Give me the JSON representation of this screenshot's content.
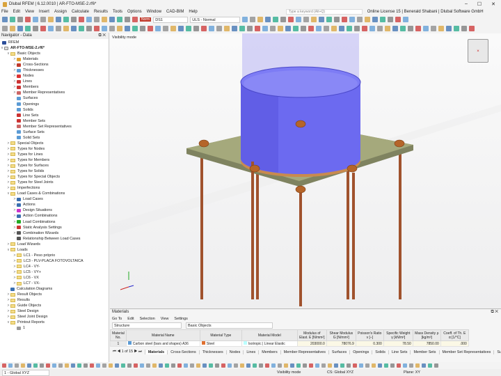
{
  "window": {
    "title": "Dlubal RFEM | 6.12.0010 | AR-FTO-MSE-2.rf6*",
    "min": "–",
    "max": "☐",
    "close": "✕"
  },
  "menu": {
    "items": [
      "File",
      "Edit",
      "View",
      "Insert",
      "Assign",
      "Calculate",
      "Results",
      "Tools",
      "Options",
      "Window",
      "CAD-BIM",
      "Help"
    ],
    "search_placeholder": "Type a keyword (Alt+Q)",
    "license": "Online License 15 | Benerald Shabani | Dlubal Software GmbH"
  },
  "toolbar": {
    "norm_badge": "Norm",
    "design_situation": "DS1",
    "combo": "ULS - Normal"
  },
  "navigator": {
    "title": "Navigator - Data",
    "root": "RFEM",
    "file": "AR-FTO-MSE-2.rf6*",
    "items": [
      {
        "l": "Basic Objects",
        "d": 1,
        "t": "folder",
        "e": "v"
      },
      {
        "l": "Materials",
        "d": 2,
        "t": "obj",
        "e": ">",
        "c": "#e0a030"
      },
      {
        "l": "Cross-Sections",
        "d": 2,
        "t": "obj",
        "e": ">",
        "c": "#c0392b"
      },
      {
        "l": "Thicknesses",
        "d": 2,
        "t": "obj",
        "e": ">",
        "c": "#5b9bd5"
      },
      {
        "l": "Nodes",
        "d": 2,
        "t": "obj",
        "e": ">",
        "c": "#d33"
      },
      {
        "l": "Lines",
        "d": 2,
        "t": "obj",
        "e": ">",
        "c": "#c33"
      },
      {
        "l": "Members",
        "d": 2,
        "t": "obj",
        "e": ">",
        "c": "#c33"
      },
      {
        "l": "Member Representatives",
        "d": 2,
        "t": "obj",
        "e": ">",
        "c": "#c66"
      },
      {
        "l": "Surfaces",
        "d": 2,
        "t": "obj",
        "e": "",
        "c": "#5b9bd5"
      },
      {
        "l": "Openings",
        "d": 2,
        "t": "obj",
        "e": "",
        "c": "#5b9bd5"
      },
      {
        "l": "Solids",
        "d": 2,
        "t": "obj",
        "e": "",
        "c": "#5b9bd5"
      },
      {
        "l": "Line Sets",
        "d": 2,
        "t": "obj",
        "e": "",
        "c": "#c33"
      },
      {
        "l": "Member Sets",
        "d": 2,
        "t": "obj",
        "e": "",
        "c": "#c33"
      },
      {
        "l": "Member Set Representatives",
        "d": 2,
        "t": "obj",
        "e": "",
        "c": "#c66"
      },
      {
        "l": "Surface Sets",
        "d": 2,
        "t": "obj",
        "e": "",
        "c": "#5b9bd5"
      },
      {
        "l": "Solid Sets",
        "d": 2,
        "t": "obj",
        "e": "",
        "c": "#5b9bd5"
      },
      {
        "l": "Special Objects",
        "d": 1,
        "t": "folder",
        "e": ">"
      },
      {
        "l": "Types for Nodes",
        "d": 1,
        "t": "folder",
        "e": ">"
      },
      {
        "l": "Types for Lines",
        "d": 1,
        "t": "folder",
        "e": ">"
      },
      {
        "l": "Types for Members",
        "d": 1,
        "t": "folder",
        "e": ">"
      },
      {
        "l": "Types for Surfaces",
        "d": 1,
        "t": "folder",
        "e": ">"
      },
      {
        "l": "Types for Solids",
        "d": 1,
        "t": "folder",
        "e": ">"
      },
      {
        "l": "Types for Special Objects",
        "d": 1,
        "t": "folder",
        "e": ">"
      },
      {
        "l": "Types for Steel Joints",
        "d": 1,
        "t": "folder",
        "e": ">"
      },
      {
        "l": "Imperfections",
        "d": 1,
        "t": "folder",
        "e": ">"
      },
      {
        "l": "Load Cases & Combinations",
        "d": 1,
        "t": "folder",
        "e": "v"
      },
      {
        "l": "Load Cases",
        "d": 2,
        "t": "obj",
        "e": ">",
        "c": "#3a6fb0"
      },
      {
        "l": "Actions",
        "d": 2,
        "t": "obj",
        "e": ">",
        "c": "#3a6fb0"
      },
      {
        "l": "Design Situations",
        "d": 2,
        "t": "obj",
        "e": ">",
        "c": "#c3c"
      },
      {
        "l": "Action Combinations",
        "d": 2,
        "t": "obj",
        "e": ">",
        "c": "#3a6fb0"
      },
      {
        "l": "Load Combinations",
        "d": 2,
        "t": "obj",
        "e": ">",
        "c": "#2a2"
      },
      {
        "l": "Static Analysis Settings",
        "d": 2,
        "t": "obj",
        "e": ">",
        "c": "#c33"
      },
      {
        "l": "Combination Wizards",
        "d": 2,
        "t": "obj",
        "e": ">",
        "c": "#555"
      },
      {
        "l": "Relationship Between Load Cases",
        "d": 2,
        "t": "obj",
        "e": "",
        "c": "#555"
      },
      {
        "l": "Load Wizards",
        "d": 1,
        "t": "folder",
        "e": ">"
      },
      {
        "l": "Loads",
        "d": 1,
        "t": "folder",
        "e": "v"
      },
      {
        "l": "LC1 - Peso próprio",
        "d": 2,
        "t": "folder",
        "e": ">"
      },
      {
        "l": "LC3 - PLV-PLACA FOTOVOLTAICA",
        "d": 2,
        "t": "folder",
        "e": ">"
      },
      {
        "l": "LC4 - VY-",
        "d": 2,
        "t": "folder",
        "e": ">"
      },
      {
        "l": "LC5 - VY+",
        "d": 2,
        "t": "folder",
        "e": ">"
      },
      {
        "l": "LC6 - VX",
        "d": 2,
        "t": "folder",
        "e": ">"
      },
      {
        "l": "LC7 - VX-",
        "d": 2,
        "t": "folder",
        "e": ">"
      },
      {
        "l": "Calculation Diagrams",
        "d": 1,
        "t": "obj",
        "e": "",
        "c": "#3a6fb0"
      },
      {
        "l": "Result Objects",
        "d": 1,
        "t": "folder",
        "e": ">"
      },
      {
        "l": "Results",
        "d": 1,
        "t": "folder",
        "e": ">"
      },
      {
        "l": "Guide Objects",
        "d": 1,
        "t": "folder",
        "e": ">"
      },
      {
        "l": "Steel Design",
        "d": 1,
        "t": "folder",
        "e": ">"
      },
      {
        "l": "Steel Joint Design",
        "d": 1,
        "t": "folder",
        "e": ">"
      },
      {
        "l": "Printout Reports",
        "d": 1,
        "t": "folder",
        "e": "v"
      },
      {
        "l": "1",
        "d": 2,
        "t": "obj",
        "e": "",
        "c": "#999"
      }
    ]
  },
  "viewport": {
    "mode_label": "Visibility mode",
    "colors": {
      "cylinder": "#6f6ef0",
      "plate": "#a3a77a",
      "rods": "#a0522d",
      "column": "#c9c8f5"
    }
  },
  "materials": {
    "title": "Materials",
    "menu": [
      "Go To",
      "Edit",
      "Selection",
      "View",
      "Settings"
    ],
    "filter1": "Structure",
    "filter2": "Basic Objects",
    "columns": [
      "Material No.",
      "Material Name",
      "Material Type",
      "Material Model",
      "Modulus of Elast. E [N/mm²]",
      "Shear Modulus G [N/mm²]",
      "Poisson's Ratio v [–]",
      "Specific Weight γ [kN/m³]",
      "Mass Density ρ [kg/m³]",
      "Coeff. of Th. E α [1/°C]"
    ],
    "rows": [
      [
        "1",
        "Carbon steel (bars and shapes) A36",
        "Steel",
        "Isotropic | Linear Elastic",
        "203000.0",
        "78076.9",
        "0.300",
        "78.50",
        "7850.00",
        ".000"
      ]
    ],
    "pager": "1 of 15",
    "tabs": [
      "Materials",
      "Cross-Sections",
      "Thicknesses",
      "Nodes",
      "Lines",
      "Members",
      "Member Representatives",
      "Surfaces",
      "Openings",
      "Solids",
      "Line Sets",
      "Member Sets",
      "Member Set Representatives",
      "Surfac"
    ]
  },
  "status": {
    "cs_combo": "1 - Global XYZ",
    "mode": "Visibility mode",
    "cs": "CS: Global XYZ",
    "plane": "Plane: XY"
  }
}
